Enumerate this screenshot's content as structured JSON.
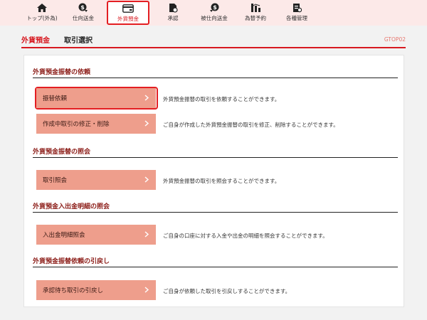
{
  "topnav": {
    "items": [
      {
        "label": "トップ(外為)",
        "icon": "home-icon"
      },
      {
        "label": "仕向送金",
        "icon": "send-money-icon"
      },
      {
        "label": "外貨預金",
        "icon": "deposit-icon",
        "active": true
      },
      {
        "label": "承認",
        "icon": "approval-icon"
      },
      {
        "label": "被仕向送金",
        "icon": "receive-money-icon"
      },
      {
        "label": "為替予約",
        "icon": "exchange-contract-icon"
      },
      {
        "label": "各種管理",
        "icon": "management-icon"
      }
    ]
  },
  "subhead": {
    "title": "外貨預金",
    "subtitle": "取引選択",
    "screen_code": "GTOP02"
  },
  "sections": [
    {
      "title": "外貨預金振替の依頼",
      "actions": [
        {
          "label": "振替依頼",
          "description": "外貨預金振替の取引を依頼することができます。"
        },
        {
          "label": "作成中取引の修正・削除",
          "description": "ご自身が作成した外貨預金振替の取引を修正、削除することができます。"
        }
      ]
    },
    {
      "title": "外貨預金振替の照会",
      "actions": [
        {
          "label": "取引照会",
          "description": "外貨預金振替の取引を照会することができます。"
        }
      ]
    },
    {
      "title": "外貨預金入出金明細の照会",
      "actions": [
        {
          "label": "入出金明細照会",
          "description": "ご自身の口座に対する入金や出金の明細を照会することができます。"
        }
      ]
    },
    {
      "title": "外貨預金振替依頼の引戻し",
      "actions": [
        {
          "label": "承認待ち取引の引戻し",
          "description": "ご自身が依頼した取引を引戻しすることができます。"
        }
      ]
    }
  ],
  "colors": {
    "brand_red": "#d71920",
    "button_salmon": "#ee9e8c",
    "section_title": "#8b1b16",
    "nav_bg": "#fce9e8"
  }
}
